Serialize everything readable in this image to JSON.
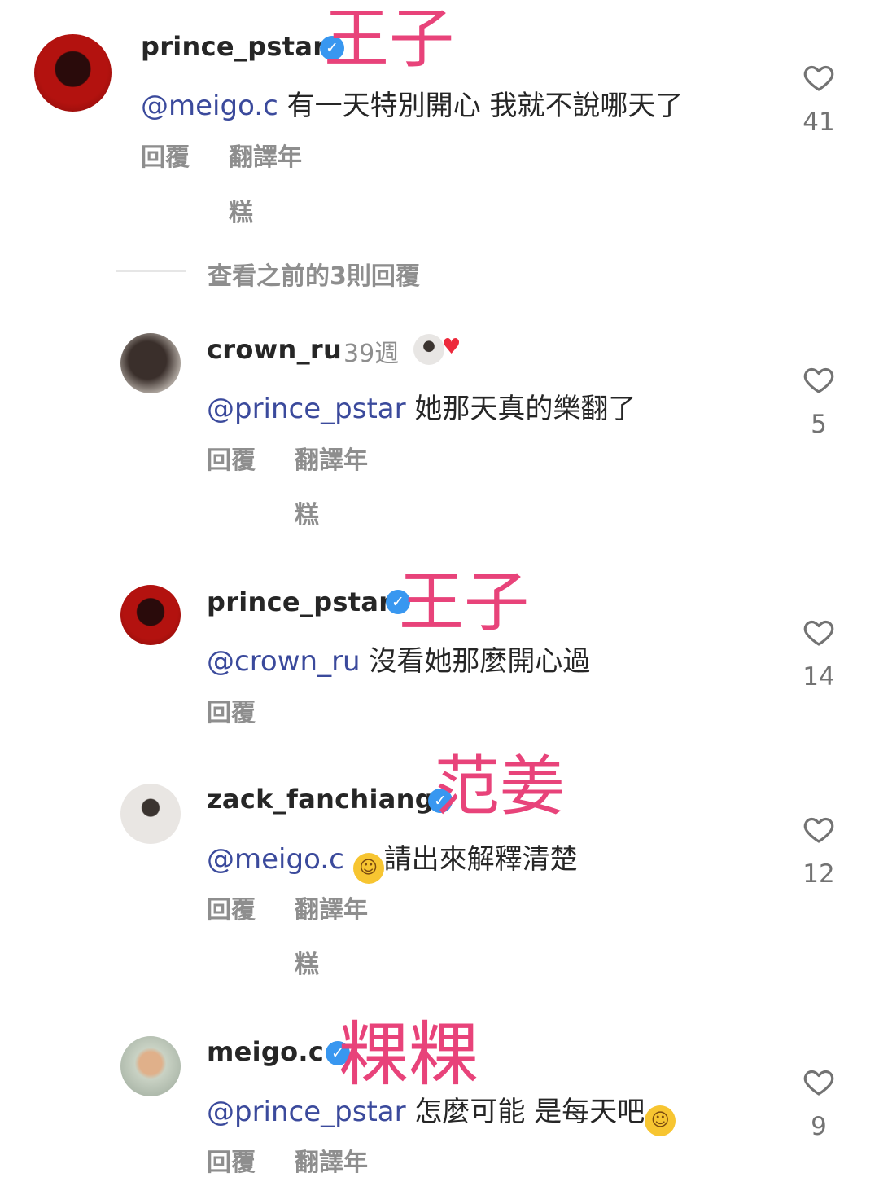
{
  "comments": [
    {
      "username": "prince_pstar",
      "verified": true,
      "time": "",
      "mention": "@meigo.c",
      "text": " 有一天特別開心 我就不說哪天了",
      "actions": [
        "回覆",
        "翻譯年",
        "糕"
      ],
      "likes": "41",
      "overlay": "王子"
    },
    {
      "username": "crown_ru",
      "verified": false,
      "time": "39週",
      "mention": "@prince_pstar",
      "text": " 她那天真的樂翻了",
      "actions": [
        "回覆",
        "翻譯年",
        "糕"
      ],
      "likes": "5",
      "overlay": ""
    },
    {
      "username": "prince_pstar",
      "verified": true,
      "time": "",
      "mention": "@crown_ru",
      "text": " 沒看她那麼開心過",
      "actions": [
        "回覆"
      ],
      "likes": "14",
      "overlay": "王子"
    },
    {
      "username": "zack_fanchiang",
      "verified": true,
      "time": "",
      "mention": "@meigo.c",
      "text": "請出來解釋清楚",
      "actions": [
        "回覆",
        "翻譯年",
        "糕"
      ],
      "likes": "12",
      "overlay": "范姜"
    },
    {
      "username": "meigo.c",
      "verified": true,
      "time": "",
      "mention": "@prince_pstar",
      "text": " 怎麼可能 是每天吧",
      "actions": [
        "回覆",
        "翻譯年"
      ],
      "likes": "9",
      "overlay": "粿粿"
    }
  ],
  "view_previous": "查看之前的3則回覆",
  "colors": {
    "overlay": "#e8437a",
    "mention": "#3b4a9c",
    "verified": "#3897f0",
    "liked_heart": "#ed2a3c"
  },
  "icons": {
    "like": "heart-outline-icon",
    "verified": "verified-badge-icon",
    "emoji_smile": "slightly-smiling-face-emoji",
    "emoji_blush": "smiling-face-emoji"
  }
}
